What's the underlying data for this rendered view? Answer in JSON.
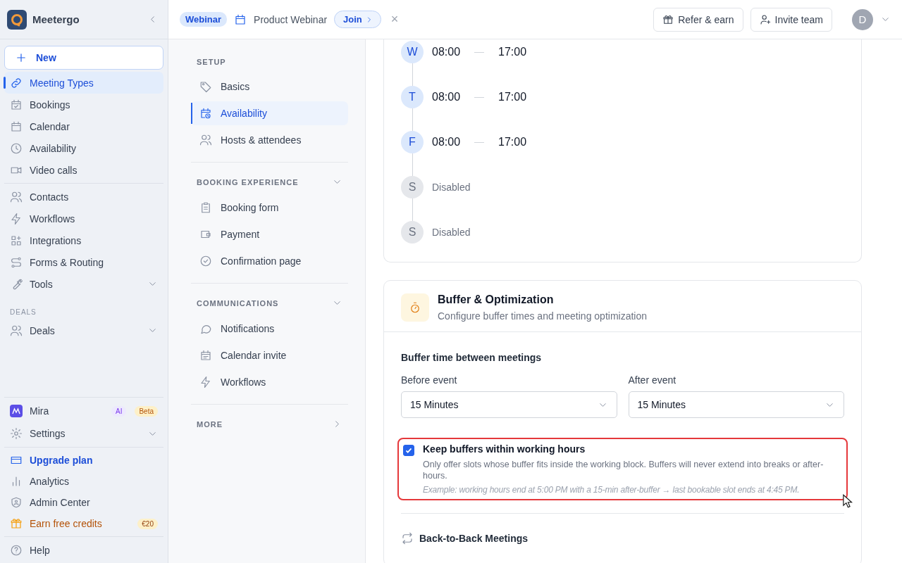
{
  "app": {
    "name": "Meetergo"
  },
  "topbar": {
    "event_badge": "Webinar",
    "event_title": "Product Webinar",
    "join_label": "Join",
    "close_label": "×",
    "actions": [
      {
        "label": "Refer & earn"
      },
      {
        "label": "Invite team"
      }
    ],
    "avatar": "D"
  },
  "sidebar": {
    "new_label": "New",
    "primary": [
      {
        "label": "Meeting Types",
        "selected": true
      },
      {
        "label": "Bookings",
        "selected": false
      },
      {
        "label": "Calendar",
        "selected": false
      },
      {
        "label": "Availability",
        "selected": false
      },
      {
        "label": "Video calls",
        "selected": false
      }
    ],
    "secondary": [
      {
        "label": "Contacts",
        "selected": false,
        "has_menu": false
      },
      {
        "label": "Workflows",
        "selected": false,
        "has_menu": false
      },
      {
        "label": "Integrations",
        "selected": false,
        "has_menu": false
      },
      {
        "label": "Forms & Routing",
        "selected": false,
        "has_menu": false
      },
      {
        "label": "Tools",
        "selected": false,
        "has_menu": true
      }
    ],
    "deals_heading": "DEALS",
    "deals": [
      {
        "label": "Deals",
        "selected": false,
        "has_menu": true
      }
    ],
    "assistant": {
      "label": "Mira",
      "badges": [
        {
          "label": "AI",
          "kind": "ai"
        },
        {
          "label": "Beta",
          "kind": "beta"
        }
      ]
    },
    "settings": {
      "label": "Settings",
      "has_menu": true
    },
    "account": [
      {
        "label": "Upgrade plan",
        "kind": "upgrade"
      },
      {
        "label": "Analytics",
        "kind": "normal"
      },
      {
        "label": "Admin Center",
        "kind": "normal"
      },
      {
        "label": "Earn free credits",
        "kind": "promo",
        "badge": "€20"
      }
    ],
    "help": "Help"
  },
  "subnav": {
    "sections": [
      {
        "heading": "SETUP",
        "collapsible": false,
        "items": [
          {
            "label": "Basics",
            "selected": false
          },
          {
            "label": "Availability",
            "selected": true
          },
          {
            "label": "Hosts & attendees",
            "selected": false
          }
        ]
      },
      {
        "heading": "BOOKING EXPERIENCE",
        "collapsible": true,
        "items": [
          {
            "label": "Booking form",
            "selected": false
          },
          {
            "label": "Payment",
            "selected": false
          },
          {
            "label": "Confirmation page",
            "selected": false
          }
        ]
      },
      {
        "heading": "COMMUNICATIONS",
        "collapsible": true,
        "items": [
          {
            "label": "Notifications",
            "selected": false
          },
          {
            "label": "Calendar invite",
            "selected": false
          },
          {
            "label": "Workflows",
            "selected": false
          }
        ]
      }
    ],
    "more": "MORE"
  },
  "schedule": {
    "days": [
      {
        "letter": "W",
        "enabled": true,
        "start": "08:00",
        "end": "17:00"
      },
      {
        "letter": "T",
        "enabled": true,
        "start": "08:00",
        "end": "17:00"
      },
      {
        "letter": "F",
        "enabled": true,
        "start": "08:00",
        "end": "17:00"
      },
      {
        "letter": "S",
        "enabled": false,
        "note": "Disabled"
      },
      {
        "letter": "S",
        "enabled": false,
        "note": "Disabled"
      }
    ]
  },
  "buffer": {
    "title": "Buffer & Optimization",
    "subtitle": "Configure buffer times and meeting optimization",
    "section_label": "Buffer time between meetings",
    "fields": [
      {
        "label": "Before event",
        "value": "15 Minutes"
      },
      {
        "label": "After event",
        "value": "15 Minutes"
      }
    ],
    "option": {
      "label": "Keep buffers within working hours",
      "checked": true,
      "highlighted": true,
      "description": "Only offer slots whose buffer fits inside the working block. Buffers will never extend into breaks or after-hours.",
      "example": "Example: working hours end at 5:00 PM with a 15-min after-buffer → last bookable slot ends at 4:45 PM."
    },
    "back_to_back": "Back-to-Back Meetings"
  }
}
